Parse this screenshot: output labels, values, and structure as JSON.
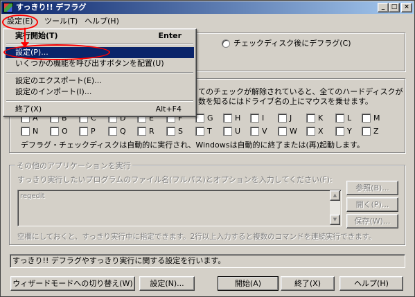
{
  "window": {
    "title": "すっきり!! デフラグ",
    "minimize": "_",
    "maximize": "□",
    "close": "×"
  },
  "menubar": {
    "settings": "設定(E)",
    "tools": "ツール(T)",
    "help": "ヘルプ(H)"
  },
  "dropdown": {
    "items": [
      {
        "label": "実行開始(T)",
        "shortcut": "Enter"
      },
      {
        "label": "設定(P)...",
        "shortcut": ""
      },
      {
        "label": "いくつかの機能を呼び出すボタンを配置(U)",
        "shortcut": ""
      },
      {
        "label": "設定のエクスポート(E)...",
        "shortcut": ""
      },
      {
        "label": "設定のインポート(I)...",
        "shortcut": ""
      },
      {
        "label": "終了(X)",
        "shortcut": "Alt+F4"
      }
    ]
  },
  "radio": {
    "label": "チェックディスク後にデフラグ(C)"
  },
  "drives": {
    "desc_line1": "てのチェックが解除されていると、全てのハードディスクが",
    "desc_line2": "数を知るにはドライブ名の上にマウスを乗せます。",
    "row1_letters": [
      "A",
      "B",
      "C",
      "D",
      "E",
      "F",
      "G",
      "H",
      "I",
      "J",
      "K",
      "L",
      "M"
    ],
    "row2_letters": [
      "N",
      "O",
      "P",
      "Q",
      "R",
      "S",
      "T",
      "U",
      "V",
      "W",
      "X",
      "Y",
      "Z"
    ],
    "note": "デフラグ・チェックディスクは自動的に実行され、Windowsは自動的に終了または(再)起動します。"
  },
  "apps": {
    "group_title": "その他のアプリケーションを実行",
    "prompt": "すっきり実行したいプログラムのファイル名(フルパス)とオプションを入力してください(F):",
    "value": "regedit",
    "browse": "参照(B)...",
    "open": "開く(P)...",
    "save": "保存(W)...",
    "hint": "空欄にしておくと、すっきり実行中に指定できます。2行以上入力すると複数のコマンドを連続実行できます。"
  },
  "status": {
    "text": "すっきり!! デフラグやすっきり実行に関する設定を行います。"
  },
  "buttons": {
    "wizard": "ウィザードモードへの切り替え(W)",
    "settings": "設定(N)...",
    "start": "開始(A)",
    "exit": "終了(X)",
    "help": "ヘルプ(H)"
  }
}
